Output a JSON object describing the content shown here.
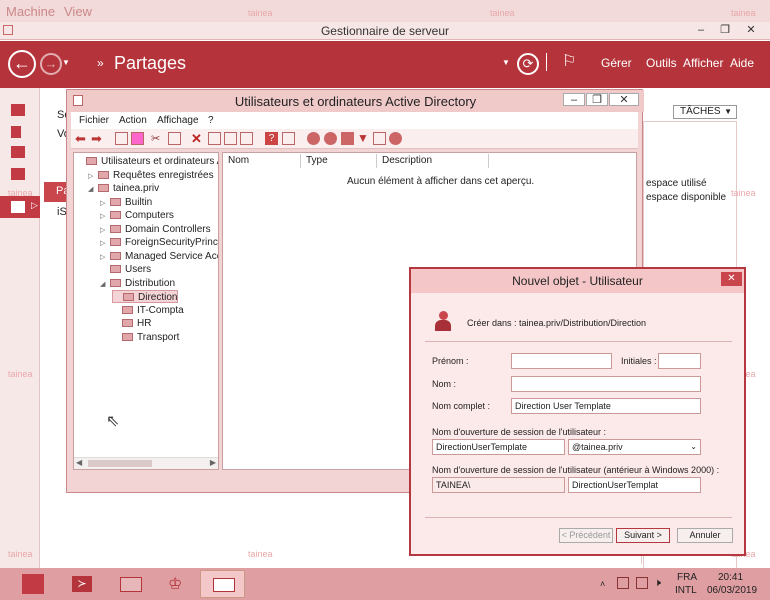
{
  "vm": {
    "menu": [
      "Machine",
      "View"
    ]
  },
  "watermark": "tainea",
  "server_manager": {
    "title": "Gestionnaire de serveur",
    "breadcrumb": "Partages",
    "nav": [
      "Gérer",
      "Outils",
      "Afficher",
      "Aide"
    ],
    "tasks_label": "TÂCHES",
    "partial_left": [
      "Se",
      "Vo",
      "Pa",
      "iS"
    ],
    "partial_right": [
      "espace utilisé",
      "espace disponible"
    ]
  },
  "ad_window": {
    "title": "Utilisateurs et ordinateurs Active Directory",
    "menu": [
      "Fichier",
      "Action",
      "Affichage",
      "?"
    ],
    "tree": [
      {
        "label": "Utilisateurs et ordinateurs Active",
        "indent": 0,
        "expander": ""
      },
      {
        "label": "Requêtes enregistrées",
        "indent": 1,
        "expander": "▷"
      },
      {
        "label": "tainea.priv",
        "indent": 1,
        "expander": "◢"
      },
      {
        "label": "Builtin",
        "indent": 2,
        "expander": "▷"
      },
      {
        "label": "Computers",
        "indent": 2,
        "expander": "▷"
      },
      {
        "label": "Domain Controllers",
        "indent": 2,
        "expander": "▷"
      },
      {
        "label": "ForeignSecurityPrincipals",
        "indent": 2,
        "expander": "▷"
      },
      {
        "label": "Managed Service Accour",
        "indent": 2,
        "expander": "▷"
      },
      {
        "label": "Users",
        "indent": 2,
        "expander": ""
      },
      {
        "label": "Distribution",
        "indent": 2,
        "expander": "◢"
      },
      {
        "label": "Direction",
        "indent": 3,
        "expander": ""
      },
      {
        "label": "IT-Compta",
        "indent": 3,
        "expander": ""
      },
      {
        "label": "HR",
        "indent": 3,
        "expander": ""
      },
      {
        "label": "Transport",
        "indent": 3,
        "expander": ""
      }
    ],
    "selected_index": 10,
    "columns": [
      "Nom",
      "Type",
      "Description"
    ],
    "empty_message": "Aucun élément à afficher dans cet aperçu."
  },
  "dialog": {
    "title": "Nouvel objet - Utilisateur",
    "create_in_label": "Créer dans :",
    "create_in_path": "tainea.priv/Distribution/Direction",
    "prenom_label": "Prénom :",
    "prenom_value": "",
    "initiales_label": "Initiales :",
    "initiales_value": "",
    "nom_label": "Nom :",
    "nom_value": "",
    "nom_complet_label": "Nom complet :",
    "nom_complet_value": "Direction User Template",
    "logon_label": "Nom d'ouverture de session de l'utilisateur :",
    "logon_value": "DirectionUserTemplate",
    "logon_domain": "@tainea.priv",
    "logon_legacy_label": "Nom d'ouverture de session de l'utilisateur (antérieur à Windows 2000) :",
    "legacy_domain": "TAINEA\\",
    "legacy_value": "DirectionUserTemplat",
    "btn_prev": "< Précédent",
    "btn_next": "Suivant >",
    "btn_cancel": "Annuler"
  },
  "taskbar": {
    "lang": "FRA",
    "layout": "INTL",
    "time": "20:41",
    "date": "06/03/2019"
  },
  "colors": {
    "accent": "#b5343b",
    "tint": "#f3d4d4"
  }
}
